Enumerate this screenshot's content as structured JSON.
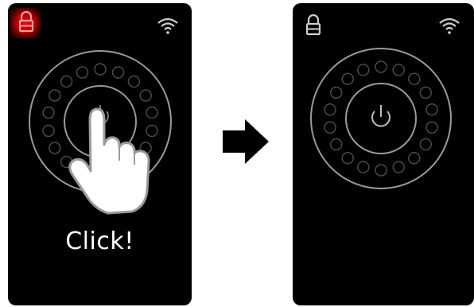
{
  "left_screen": {
    "lock_icon": "lock-icon",
    "wifi_icon": "wifi-icon",
    "power_button_icon": "power-icon",
    "pointer_icon": "hand-pointer-icon",
    "caption": "Click!",
    "lock_highlight_color": "#c00000"
  },
  "right_screen": {
    "lock_icon": "lock-icon",
    "wifi_icon": "wifi-icon",
    "power_button_icon": "power-icon"
  },
  "transition_icon": "right-arrow-icon",
  "colors": {
    "screen_bg": "#000000",
    "ring": "#9a9a9a",
    "dots": "#4a4a4a",
    "text": "#ffffff"
  }
}
